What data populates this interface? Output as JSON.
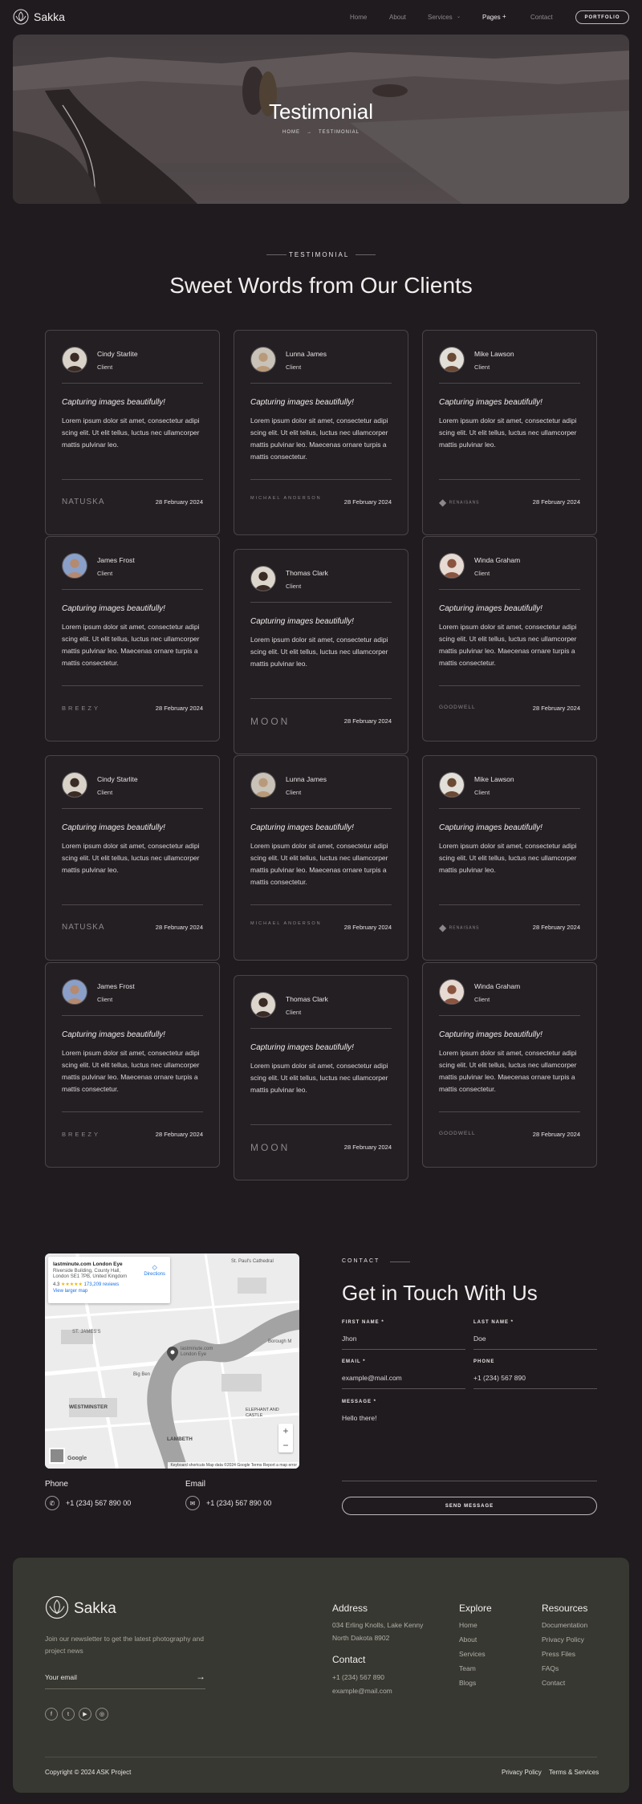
{
  "nav": {
    "brand": "Sakka",
    "items": [
      "Home",
      "About",
      "Services",
      "Pages",
      "Contact"
    ],
    "cta": "PORTFOLIO"
  },
  "hero": {
    "title": "Testimonial",
    "crumb_home": "HOME",
    "crumb_arrow": "→",
    "crumb_current": "TESTIMONIAL"
  },
  "testimonials": {
    "eyebrow": "TESTIMONIAL",
    "heading": "Sweet Words from Our Clients",
    "cards": [
      {
        "name": "Cindy Starlite",
        "role": "Client",
        "quote": "Capturing images beautifully!",
        "body": "Lorem ipsum dolor sit amet, consectetur adipi scing elit. Ut elit tellus, luctus nec ullamcorper mattis pulvinar leo.",
        "brand": "NATUSKA",
        "date": "28 February 2024"
      },
      {
        "name": "Lunna James",
        "role": "Client",
        "quote": "Capturing images beautifully!",
        "body": "Lorem ipsum dolor sit amet, consectetur adipi scing elit. Ut elit tellus, luctus nec ullamcorper mattis pulvinar leo. Maecenas ornare turpis a mattis consectetur.",
        "brand": "MICHAEL ANDERSON",
        "date": "28 February 2024"
      },
      {
        "name": "Mike Lawson",
        "role": "Client",
        "quote": "Capturing images beautifully!",
        "body": "Lorem ipsum dolor sit amet, consectetur adipi scing elit. Ut elit tellus, luctus nec ullamcorper mattis pulvinar leo.",
        "brand": "RENAISANS",
        "date": "28 February 2024"
      },
      {
        "name": "James Frost",
        "role": "Client",
        "quote": "Capturing images beautifully!",
        "body": "Lorem ipsum dolor sit amet, consectetur adipi scing elit. Ut elit tellus, luctus nec ullamcorper mattis pulvinar leo. Maecenas ornare turpis a mattis consectetur.",
        "brand": "BREEZY",
        "date": "28 February 2024"
      },
      {
        "name": "Thomas Clark",
        "role": "Client",
        "quote": "Capturing images beautifully!",
        "body": "Lorem ipsum dolor sit amet, consectetur adipi scing elit. Ut elit tellus, luctus nec ullamcorper mattis pulvinar leo.",
        "brand": "MOON",
        "date": "28 February 2024"
      },
      {
        "name": "Winda Graham",
        "role": "Client",
        "quote": "Capturing images beautifully!",
        "body": "Lorem ipsum dolor sit amet, consectetur adipi scing elit. Ut elit tellus, luctus nec ullamcorper mattis pulvinar leo. Maecenas ornare turpis a mattis consectetur.",
        "brand": "GOODWELL",
        "date": "28 February 2024"
      },
      {
        "name": "Cindy Starlite",
        "role": "Client",
        "quote": "Capturing images beautifully!",
        "body": "Lorem ipsum dolor sit amet, consectetur adipi scing elit. Ut elit tellus, luctus nec ullamcorper mattis pulvinar leo.",
        "brand": "NATUSKA",
        "date": "28 February 2024"
      },
      {
        "name": "Lunna James",
        "role": "Client",
        "quote": "Capturing images beautifully!",
        "body": "Lorem ipsum dolor sit amet, consectetur adipi scing elit. Ut elit tellus, luctus nec ullamcorper mattis pulvinar leo. Maecenas ornare turpis a mattis consectetur.",
        "brand": "MICHAEL ANDERSON",
        "date": "28 February 2024"
      },
      {
        "name": "Mike Lawson",
        "role": "Client",
        "quote": "Capturing images beautifully!",
        "body": "Lorem ipsum dolor sit amet, consectetur adipi scing elit. Ut elit tellus, luctus nec ullamcorper mattis pulvinar leo.",
        "brand": "RENAISANS",
        "date": "28 February 2024"
      },
      {
        "name": "James Frost",
        "role": "Client",
        "quote": "Capturing images beautifully!",
        "body": "Lorem ipsum dolor sit amet, consectetur adipi scing elit. Ut elit tellus, luctus nec ullamcorper mattis pulvinar leo. Maecenas ornare turpis a mattis consectetur.",
        "brand": "BREEZY",
        "date": "28 February 2024"
      },
      {
        "name": "Thomas Clark",
        "role": "Client",
        "quote": "Capturing images beautifully!",
        "body": "Lorem ipsum dolor sit amet, consectetur adipi scing elit. Ut elit tellus, luctus nec ullamcorper mattis pulvinar leo.",
        "brand": "MOON",
        "date": "28 February 2024"
      },
      {
        "name": "Winda Graham",
        "role": "Client",
        "quote": "Capturing images beautifully!",
        "body": "Lorem ipsum dolor sit amet, consectetur adipi scing elit. Ut elit tellus, luctus nec ullamcorper mattis pulvinar leo. Maecenas ornare turpis a mattis consectetur.",
        "brand": "GOODWELL",
        "date": "28 February 2024"
      }
    ]
  },
  "map": {
    "place": "lastminute.com London Eye",
    "address": "Riverside Building, County Hall, London SE1 7PB, United Kingdom",
    "rating": "4.3",
    "stars": "★★★★★",
    "reviews": "173,209 reviews",
    "larger": "View larger map",
    "directions": "Directions",
    "pin_label": "lastminute.com London Eye",
    "labels": [
      "ST. JAMES'S",
      "WESTMINSTER",
      "LAMBETH",
      "ELEPHANT AND CASTLE",
      "Big Ben",
      "Borough M",
      "St. Paul's Cathedral"
    ],
    "footer": "Keyboard shortcuts   Map data ©2024 Google   Terms   Report a map error",
    "google": "Google",
    "zoom_in": "+",
    "zoom_out": "−"
  },
  "contact": {
    "phone_label": "Phone",
    "phone_value": "+1 (234) 567 890 00",
    "email_label": "Email",
    "email_value": "+1 (234) 567 890 00",
    "eyebrow": "CONTACT",
    "heading": "Get in Touch With Us",
    "first_name_label": "FIRST NAME *",
    "first_name_value": "Jhon",
    "last_name_label": "LAST NAME *",
    "last_name_value": "Doe",
    "email_field_label": "EMAIL *",
    "email_field_value": "example@mail.com",
    "phone_field_label": "PHONE",
    "phone_field_value": "+1 (234) 567 890",
    "message_label": "MESSAGE *",
    "message_value": "Hello there!",
    "send": "SEND MESSAGE"
  },
  "footer": {
    "brand": "Sakka",
    "tagline": "Join our newsletter to get the latest photography and project news",
    "newsletter_placeholder": "Your email",
    "arrow": "→",
    "social": [
      "f",
      "t",
      "▶",
      "◎"
    ],
    "address_title": "Address",
    "address_lines": [
      "034 Erling Knolls, Lake Kenny",
      "North Dakota 8902"
    ],
    "contact_title": "Contact",
    "contact_lines": [
      "+1 (234) 567 890",
      "example@mail.com"
    ],
    "explore_title": "Explore",
    "explore": [
      "Home",
      "About",
      "Services",
      "Team",
      "Blogs"
    ],
    "resources_title": "Resources",
    "resources": [
      "Documentation",
      "Privacy Policy",
      "Press Files",
      "FAQs",
      "Contact"
    ],
    "copyright": "Copyright © 2024 ASK Project",
    "legal": [
      "Privacy Policy",
      "Terms & Services"
    ]
  }
}
